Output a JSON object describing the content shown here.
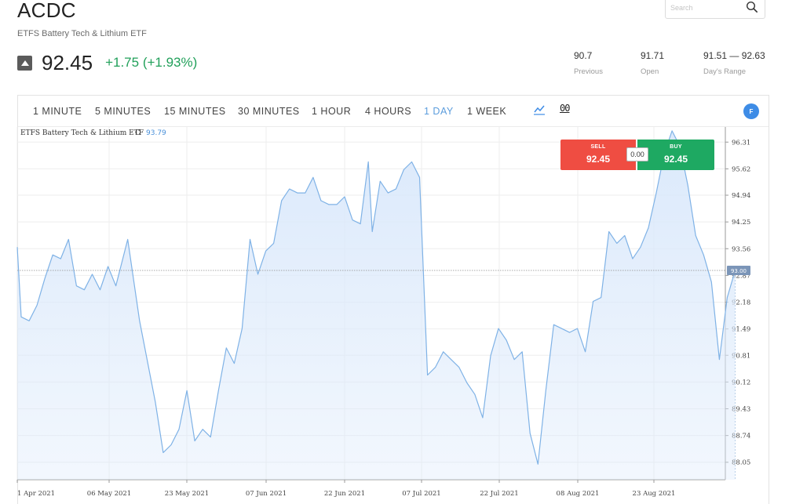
{
  "header": {
    "symbol": "ACDC",
    "full_name": "ETFS Battery Tech & Lithium ETF",
    "price": "92.45",
    "change": "+1.75 (+1.93%)",
    "direction_icon": "triangle-up-icon"
  },
  "search": {
    "placeholder": "Search",
    "icon": "magnifier-icon"
  },
  "stats": [
    {
      "value": "90.7",
      "label": "Previous"
    },
    {
      "value": "91.71",
      "label": "Open"
    },
    {
      "value": "91.51 — 92.63",
      "label": "Day's Range"
    }
  ],
  "toolbar": {
    "timeframes": [
      "1 MINUTE",
      "5 MINUTES",
      "15 MINUTES",
      "30 MINUTES",
      "1 HOUR",
      "4 HOURS",
      "1 DAY",
      "1 WEEK"
    ],
    "active_timeframe": "1 DAY",
    "chart_type_icon": "line-chart-icon",
    "indicator_icon": "glasses-icon",
    "indicator_glyph": "00",
    "fullscreen_label": "F"
  },
  "trade": {
    "sell_label": "SELL",
    "sell_price": "92.45",
    "buy_label": "BUY",
    "buy_price": "92.45",
    "spread": "0.00"
  },
  "colors": {
    "accent": "#5c9ddd",
    "up": "#21a05a",
    "sell": "#ef4d42",
    "buy": "#1ea962",
    "line": "#7fb2e6",
    "fill": "#dbe9fb",
    "badge": "#7b95b8"
  },
  "chart_data": {
    "type": "area",
    "legend_symbol": "ETFS Battery Tech & Lithium ETF",
    "legend_field": "C",
    "legend_value": "93.79",
    "x_ticks": [
      "1 Apr 2021",
      "06 May 2021",
      "23 May 2021",
      "07 Jun 2021",
      "22 Jun 2021",
      "07 Jul 2021",
      "22 Jul 2021",
      "08 Aug 2021",
      "23 Aug 2021"
    ],
    "y_ticks": [
      "96.31",
      "95.62",
      "94.94",
      "94.25",
      "93.56",
      "92.87",
      "92.18",
      "91.49",
      "90.81",
      "90.12",
      "89.43",
      "88.74",
      "88.05"
    ],
    "ylim": [
      87.6,
      96.7
    ],
    "last_price_label": "93.00",
    "last_price": 93.0,
    "grid": true,
    "x_day0": "2021-03-31",
    "x_day_span": 162,
    "points": [
      [
        "2021-03-31",
        93.6
      ],
      [
        "2021-04-01",
        91.8
      ],
      [
        "2021-04-03",
        91.7
      ],
      [
        "2021-04-05",
        92.1
      ],
      [
        "2021-04-07",
        92.8
      ],
      [
        "2021-04-09",
        93.4
      ],
      [
        "2021-04-11",
        93.3
      ],
      [
        "2021-04-13",
        93.8
      ],
      [
        "2021-04-15",
        92.6
      ],
      [
        "2021-04-17",
        92.5
      ],
      [
        "2021-04-19",
        92.9
      ],
      [
        "2021-04-21",
        92.5
      ],
      [
        "2021-04-23",
        93.1
      ],
      [
        "2021-04-25",
        92.6
      ],
      [
        "2021-04-28",
        93.8
      ],
      [
        "2021-05-01",
        91.7
      ],
      [
        "2021-05-05",
        89.6
      ],
      [
        "2021-05-07",
        88.3
      ],
      [
        "2021-05-09",
        88.5
      ],
      [
        "2021-05-11",
        88.9
      ],
      [
        "2021-05-13",
        89.9
      ],
      [
        "2021-05-15",
        88.6
      ],
      [
        "2021-05-17",
        88.9
      ],
      [
        "2021-05-19",
        88.7
      ],
      [
        "2021-05-21",
        89.9
      ],
      [
        "2021-05-23",
        91.0
      ],
      [
        "2021-05-25",
        90.6
      ],
      [
        "2021-05-27",
        91.5
      ],
      [
        "2021-05-29",
        93.8
      ],
      [
        "2021-05-31",
        92.9
      ],
      [
        "2021-06-02",
        93.5
      ],
      [
        "2021-06-04",
        93.7
      ],
      [
        "2021-06-06",
        94.8
      ],
      [
        "2021-06-08",
        95.1
      ],
      [
        "2021-06-10",
        95.0
      ],
      [
        "2021-06-12",
        95.0
      ],
      [
        "2021-06-14",
        95.4
      ],
      [
        "2021-06-16",
        94.8
      ],
      [
        "2021-06-18",
        94.7
      ],
      [
        "2021-06-20",
        94.7
      ],
      [
        "2021-06-22",
        94.9
      ],
      [
        "2021-06-24",
        94.3
      ],
      [
        "2021-06-26",
        94.2
      ],
      [
        "2021-06-28",
        95.8
      ],
      [
        "2021-06-29",
        94.0
      ],
      [
        "2021-07-01",
        95.3
      ],
      [
        "2021-07-03",
        95.0
      ],
      [
        "2021-07-05",
        95.1
      ],
      [
        "2021-07-07",
        95.6
      ],
      [
        "2021-07-09",
        95.8
      ],
      [
        "2021-07-11",
        95.4
      ],
      [
        "2021-07-13",
        90.3
      ],
      [
        "2021-07-15",
        90.5
      ],
      [
        "2021-07-17",
        90.9
      ],
      [
        "2021-07-19",
        90.7
      ],
      [
        "2021-07-21",
        90.5
      ],
      [
        "2021-07-23",
        90.1
      ],
      [
        "2021-07-25",
        89.8
      ],
      [
        "2021-07-27",
        89.2
      ],
      [
        "2021-07-29",
        90.8
      ],
      [
        "2021-07-31",
        91.5
      ],
      [
        "2021-08-02",
        91.2
      ],
      [
        "2021-08-04",
        90.7
      ],
      [
        "2021-08-06",
        90.9
      ],
      [
        "2021-08-08",
        88.8
      ],
      [
        "2021-08-10",
        88.0
      ],
      [
        "2021-08-12",
        89.9
      ],
      [
        "2021-08-14",
        91.6
      ],
      [
        "2021-08-16",
        91.5
      ],
      [
        "2021-08-18",
        91.4
      ],
      [
        "2021-08-20",
        91.5
      ],
      [
        "2021-08-22",
        90.9
      ],
      [
        "2021-08-24",
        92.2
      ],
      [
        "2021-08-26",
        92.3
      ],
      [
        "2021-08-28",
        94.0
      ],
      [
        "2021-08-30",
        93.7
      ],
      [
        "2021-09-01",
        93.9
      ],
      [
        "2021-09-03",
        93.3
      ],
      [
        "2021-09-05",
        93.6
      ],
      [
        "2021-09-07",
        94.1
      ],
      [
        "2021-09-09",
        95.0
      ],
      [
        "2021-09-11",
        96.0
      ],
      [
        "2021-09-13",
        96.6
      ],
      [
        "2021-09-15",
        96.2
      ],
      [
        "2021-09-17",
        95.2
      ],
      [
        "2021-09-19",
        93.9
      ],
      [
        "2021-09-21",
        93.4
      ],
      [
        "2021-09-23",
        92.7
      ],
      [
        "2021-09-25",
        90.7
      ],
      [
        "2021-09-27",
        92.3
      ],
      [
        "2021-09-29",
        93.0
      ]
    ]
  }
}
